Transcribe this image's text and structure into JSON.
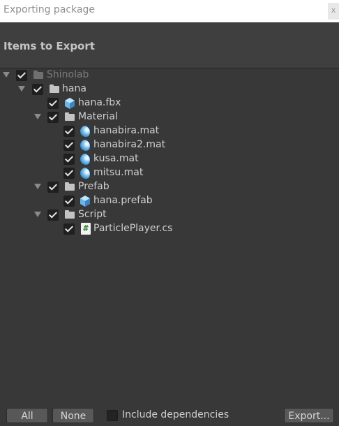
{
  "window": {
    "title": "Exporting package",
    "close_glyph": "x"
  },
  "header": {
    "title": "Items to Export"
  },
  "tree": {
    "items": [
      {
        "label": "Shinolab",
        "icon": "folder-icon",
        "checked": true,
        "expanded": true,
        "dim": true
      },
      {
        "label": "hana",
        "icon": "folder-icon",
        "checked": true,
        "expanded": true
      },
      {
        "label": "hana.fbx",
        "icon": "prefab-cube-icon",
        "checked": true
      },
      {
        "label": "Material",
        "icon": "folder-icon",
        "checked": true,
        "expanded": true
      },
      {
        "label": "hanabira.mat",
        "icon": "material-sphere-icon",
        "checked": true
      },
      {
        "label": "hanabira2.mat",
        "icon": "material-sphere-icon",
        "checked": true
      },
      {
        "label": "kusa.mat",
        "icon": "material-sphere-icon",
        "checked": true
      },
      {
        "label": "mitsu.mat",
        "icon": "material-sphere-icon",
        "checked": true
      },
      {
        "label": "Prefab",
        "icon": "folder-icon",
        "checked": true,
        "expanded": true
      },
      {
        "label": "hana.prefab",
        "icon": "prefab-cube-icon",
        "checked": true
      },
      {
        "label": "Script",
        "icon": "folder-icon",
        "checked": true,
        "expanded": true
      },
      {
        "label": "ParticlePlayer.cs",
        "icon": "csharp-script-icon",
        "checked": true,
        "glyph": "#"
      }
    ]
  },
  "footer": {
    "all_label": "All",
    "none_label": "None",
    "include_dependencies_label": "Include dependencies",
    "include_dependencies_checked": false,
    "export_label": "Export..."
  },
  "colors": {
    "background": "#383838",
    "header": "#3f3f3f",
    "button": "#585858",
    "checkbox": "#1f1f1f",
    "material_blue": "#3d8fcc",
    "script_green": "#3c8a3c"
  }
}
